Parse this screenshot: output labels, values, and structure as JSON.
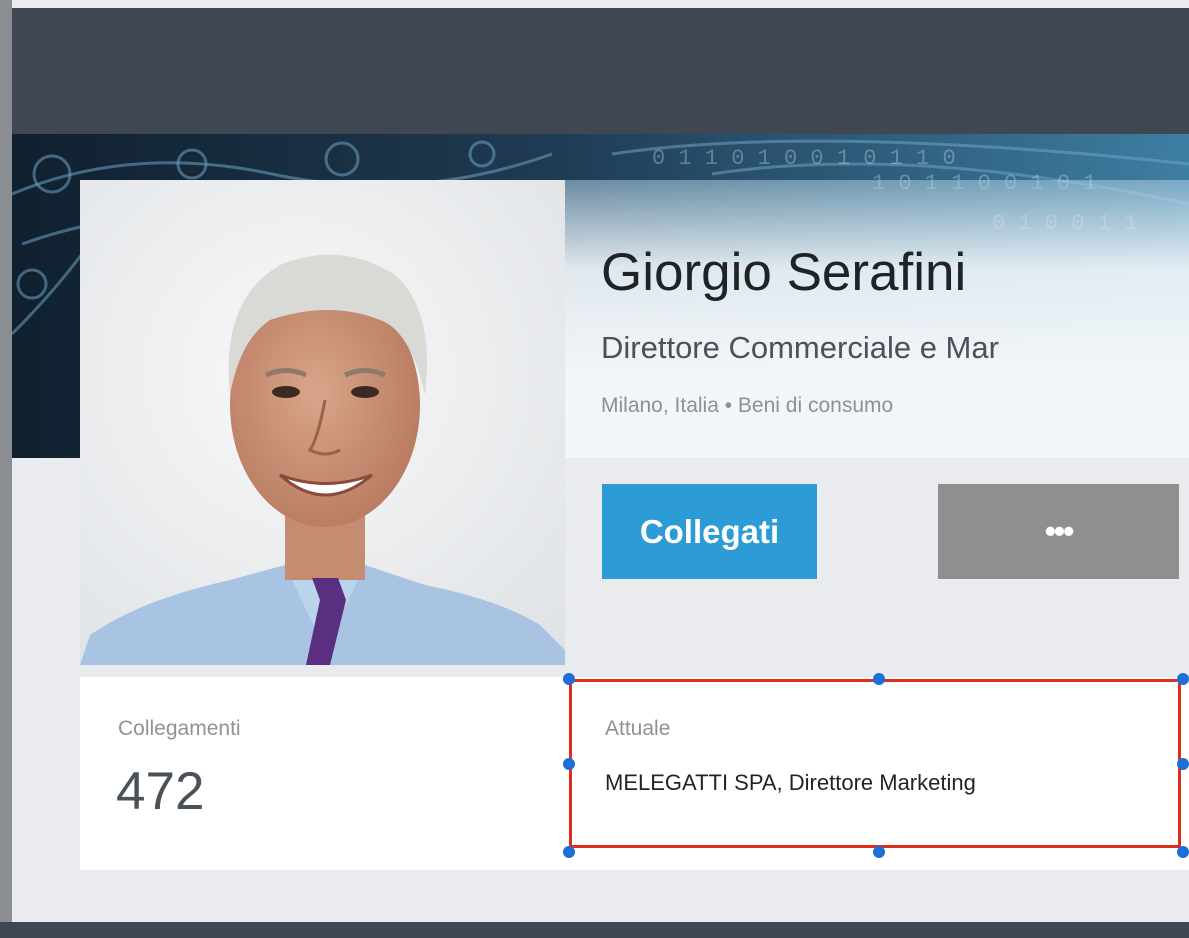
{
  "profile": {
    "name": "Giorgio Serafini",
    "headline": "Direttore Commerciale e Mar",
    "location": "Milano, Italia • Beni di consumo"
  },
  "actions": {
    "connect_label": "Collegati",
    "more_label": "•••"
  },
  "stats": {
    "connections_label": "Collegamenti",
    "connections_count": "472",
    "current_label": "Attuale",
    "current_value": "MELEGATTI SPA, Direttore Marketing"
  },
  "colors": {
    "topbar": "#3f4752",
    "connect_button": "#2c9bd6",
    "more_button": "#8f8f8f",
    "selection_outline": "#e02b1d",
    "selection_handle": "#1b6fd6"
  }
}
